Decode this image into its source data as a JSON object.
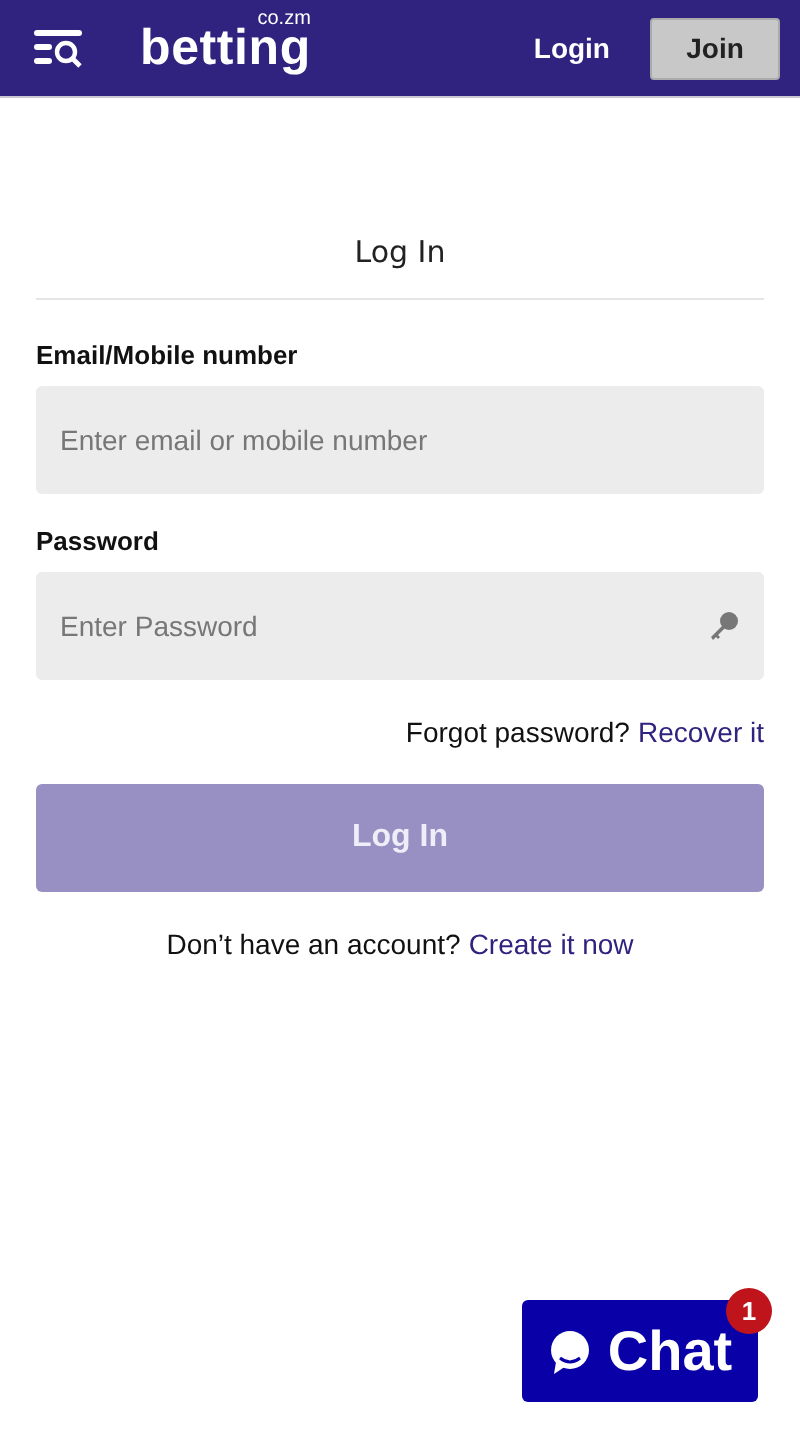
{
  "header": {
    "logo": "betting",
    "logo_suffix": "co.zm",
    "login": "Login",
    "join": "Join"
  },
  "form": {
    "title": "Log In",
    "fields": [
      {
        "label": "Email/Mobile number",
        "placeholder": "Enter email or mobile number",
        "kind": "text"
      },
      {
        "label": "Password",
        "placeholder": "Enter Password",
        "kind": "password"
      }
    ],
    "forgot": {
      "text": "Forgot password?",
      "link": "Recover it"
    },
    "submit": {
      "label": "Log In",
      "disabled": true
    },
    "signup": {
      "text": "Don’t have an account?",
      "link": "Create it now"
    }
  },
  "chat": {
    "label": "Chat",
    "badge": "1"
  }
}
